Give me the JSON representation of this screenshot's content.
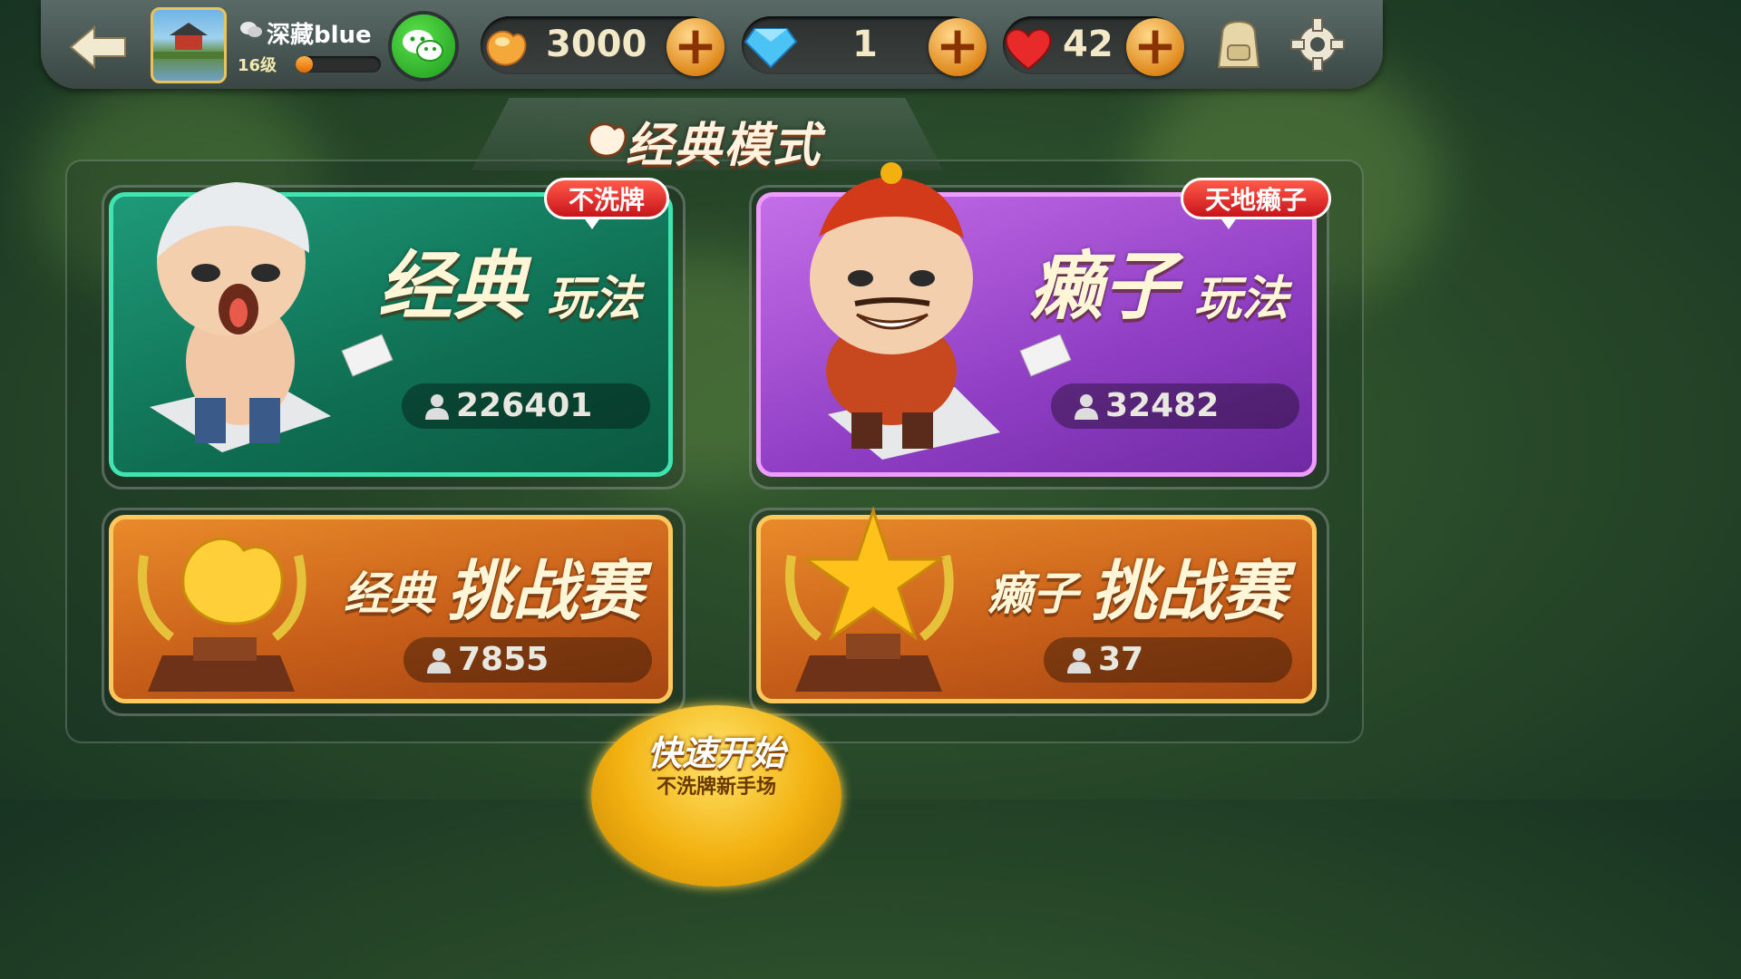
{
  "topbar": {
    "username": "深藏blue",
    "level": "16级",
    "level_progress": 0.2,
    "coins": "3000",
    "diamonds": "1",
    "hearts": "42"
  },
  "section_title": "经典模式",
  "cards": {
    "classic": {
      "title_big": "经典",
      "title_small": "玩法",
      "badge": "不洗牌",
      "players": "226401"
    },
    "laizi": {
      "title_big": "癞子",
      "title_small": "玩法",
      "badge": "天地癞子",
      "players": "32482"
    },
    "classic_challenge": {
      "title_small": "经典",
      "title_big": "挑战赛",
      "players": "7855"
    },
    "laizi_challenge": {
      "title_small": "癞子",
      "title_big": "挑战赛",
      "players": "37"
    }
  },
  "quick_start": {
    "label": "快速开始",
    "sub": "不洗牌新手场"
  },
  "icons": [
    "back-arrow-icon",
    "wechat-icon",
    "coin-icon",
    "diamond-icon",
    "heart-icon",
    "plus-icon",
    "backpack-icon",
    "gear-icon",
    "person-icon",
    "trophy-icon",
    "star-icon"
  ],
  "colors": {
    "green_card": "#1e9a78",
    "purple_card": "#8f3ec4",
    "orange_card": "#c9601a",
    "accent_gold": "#f2b10f"
  }
}
